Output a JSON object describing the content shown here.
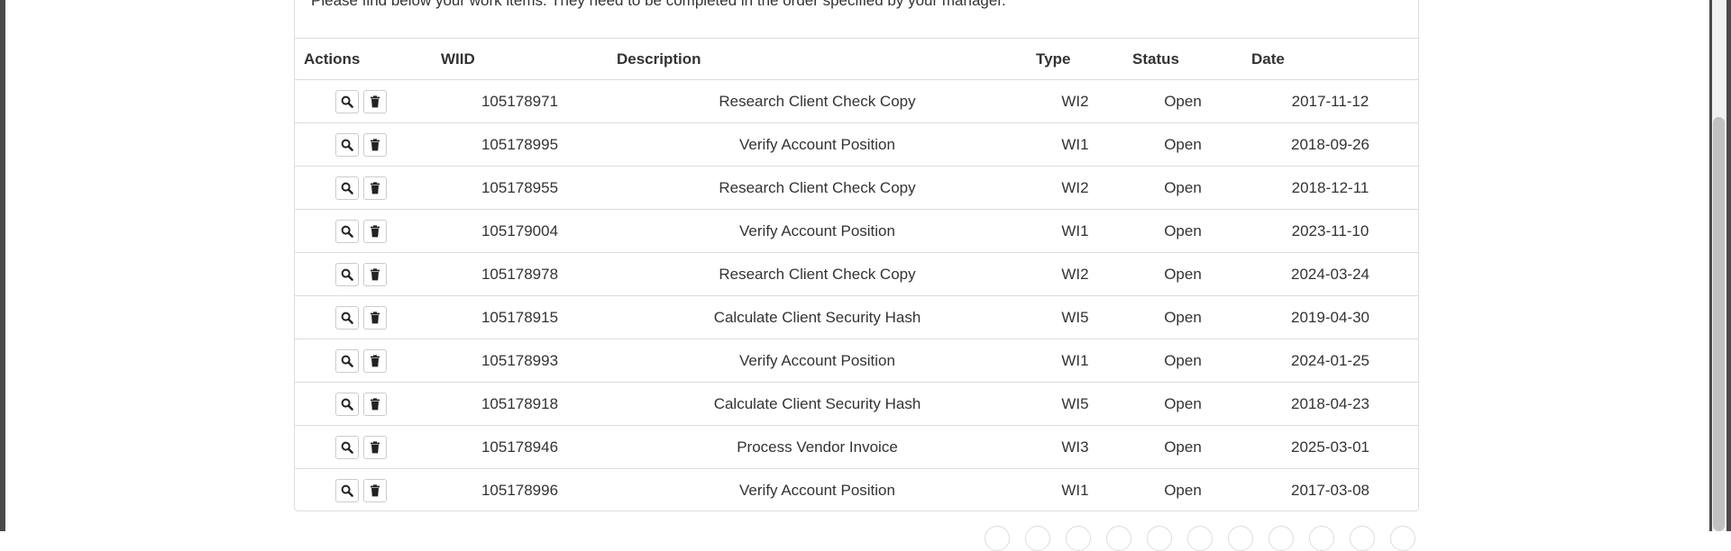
{
  "intro_text": "Please find below your work items. They need to be completed in the order specified by your manager.",
  "table": {
    "headers": {
      "actions": "Actions",
      "wiid": "WIID",
      "description": "Description",
      "type": "Type",
      "status": "Status",
      "date": "Date"
    },
    "rows": [
      {
        "wiid": "105178971",
        "description": "Research Client Check Copy",
        "type": "WI2",
        "status": "Open",
        "date": "2017-11-12"
      },
      {
        "wiid": "105178995",
        "description": "Verify Account Position",
        "type": "WI1",
        "status": "Open",
        "date": "2018-09-26"
      },
      {
        "wiid": "105178955",
        "description": "Research Client Check Copy",
        "type": "WI2",
        "status": "Open",
        "date": "2018-12-11"
      },
      {
        "wiid": "105179004",
        "description": "Verify Account Position",
        "type": "WI1",
        "status": "Open",
        "date": "2023-11-10"
      },
      {
        "wiid": "105178978",
        "description": "Research Client Check Copy",
        "type": "WI2",
        "status": "Open",
        "date": "2024-03-24"
      },
      {
        "wiid": "105178915",
        "description": "Calculate Client Security Hash",
        "type": "WI5",
        "status": "Open",
        "date": "2019-04-30"
      },
      {
        "wiid": "105178993",
        "description": "Verify Account Position",
        "type": "WI1",
        "status": "Open",
        "date": "2024-01-25"
      },
      {
        "wiid": "105178918",
        "description": "Calculate Client Security Hash",
        "type": "WI5",
        "status": "Open",
        "date": "2018-04-23"
      },
      {
        "wiid": "105178946",
        "description": "Process Vendor Invoice",
        "type": "WI3",
        "status": "Open",
        "date": "2025-03-01"
      },
      {
        "wiid": "105178996",
        "description": "Verify Account Position",
        "type": "WI1",
        "status": "Open",
        "date": "2017-03-08"
      }
    ]
  },
  "icons": {
    "view": "search-icon",
    "delete": "trash-icon"
  }
}
